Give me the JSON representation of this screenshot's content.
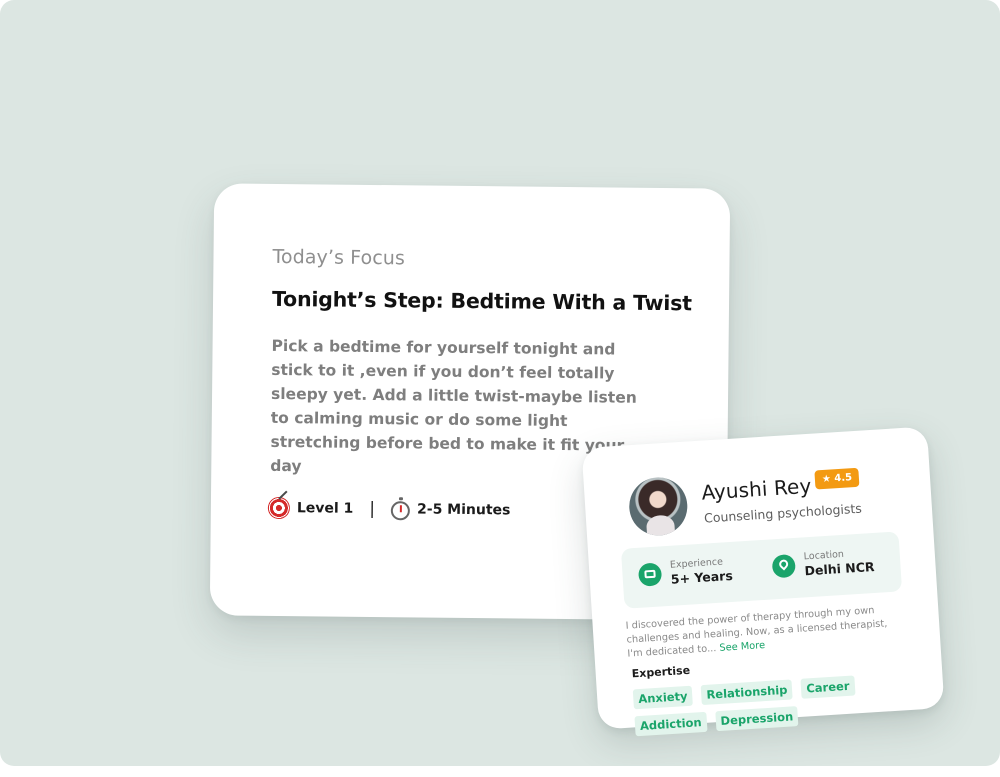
{
  "focus_card": {
    "eyebrow": "Today’s Focus",
    "title": "Tonight’s Step: Bedtime With a Twist",
    "body": "Pick a bedtime for yourself tonight and stick to it ,even if you don’t feel totally sleepy yet. Add a little twist-maybe listen to calming music or do some light stretching before bed to make it fit your day",
    "level_icon": "target-icon",
    "level": "Level 1",
    "separator": "|",
    "duration_icon": "stopwatch-icon",
    "duration": "2-5 Minutes"
  },
  "therapist_card": {
    "name": "Ayushi Rey",
    "rating": "★ 4.5",
    "role": "Counseling psychologists",
    "experience": {
      "icon": "briefcase-icon",
      "label": "Experience",
      "value": "5+ Years"
    },
    "location": {
      "icon": "location-pin-icon",
      "label": "Location",
      "value": "Delhi NCR"
    },
    "bio": "I discovered the power of therapy through my own challenges and healing. Now, as a licensed therapist, I'm dedicated to...",
    "see_more": "See More",
    "expertise_heading": "Expertise",
    "tags": [
      "Anxiety",
      "Relationship",
      "Career",
      "Addiction",
      "Depression"
    ]
  },
  "colors": {
    "background": "#dce6e2",
    "accent_green": "#1aa46a",
    "rating_orange": "#f39a12"
  }
}
